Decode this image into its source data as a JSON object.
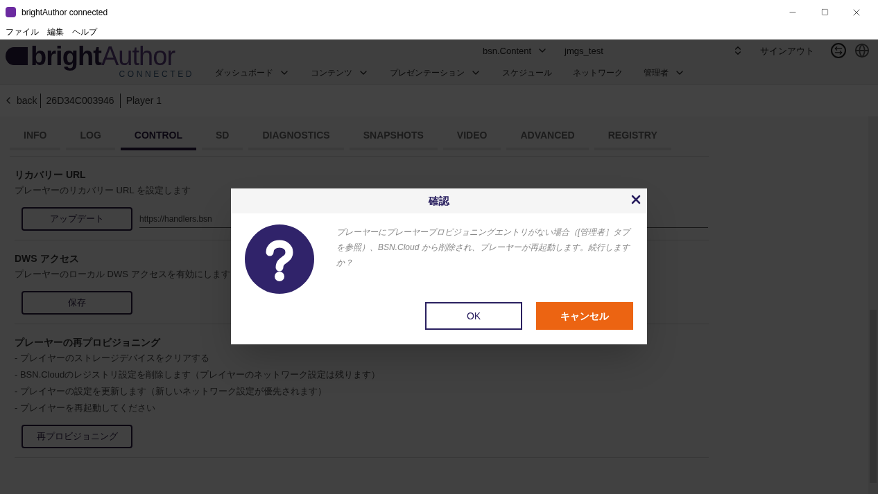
{
  "window": {
    "title": "brightAuthor connected"
  },
  "menu": [
    "ファイル",
    "編集",
    "ヘルプ"
  ],
  "header": {
    "logo_main": "bright",
    "logo_accent": "Author",
    "logo_sub": "CONNECTED",
    "network": "bsn.Content",
    "user": "jmgs_test",
    "sign_out": "サインアウト",
    "nav": [
      {
        "label": "ダッシュボード",
        "dropdown": true
      },
      {
        "label": "コンテンツ",
        "dropdown": true
      },
      {
        "label": "プレゼンテーション",
        "dropdown": true
      },
      {
        "label": "スケジュール",
        "dropdown": false
      },
      {
        "label": "ネットワーク",
        "dropdown": false
      },
      {
        "label": "管理者",
        "dropdown": true
      }
    ]
  },
  "breadcrumb": {
    "back": "back",
    "serial": "26D34C003946",
    "player": "Player 1"
  },
  "tabs": [
    {
      "label": "INFO",
      "selected": false
    },
    {
      "label": "LOG",
      "selected": false
    },
    {
      "label": "CONTROL",
      "selected": true
    },
    {
      "label": "SD",
      "selected": false
    },
    {
      "label": "DIAGNOSTICS",
      "selected": false
    },
    {
      "label": "SNAPSHOTS",
      "selected": false
    },
    {
      "label": "VIDEO",
      "selected": false
    },
    {
      "label": "ADVANCED",
      "selected": false
    },
    {
      "label": "REGISTRY",
      "selected": false
    }
  ],
  "sections": [
    {
      "title": "リカバリー URL",
      "description": [
        "プレーヤーのリカバリー URL を設定します"
      ],
      "button": "アップデート",
      "field_value": "https://handlers.bsn"
    },
    {
      "title": "DWS アクセス",
      "description": [
        "プレーヤーのローカル DWS アクセスを有効にします"
      ],
      "button": "保存"
    },
    {
      "title": "プレーヤーの再プロビジョニング",
      "description": [
        "- プレイヤーのストレージデバイスをクリアする",
        "- BSN.Cloudのレジストリ設定を削除します（プレイヤーのネットワーク設定は残ります）",
        "- プレイヤーの設定を更新します（新しいネットワーク設定が優先されます）",
        "- プレイヤーを再起動してください"
      ],
      "button": "再プロビジョニング"
    }
  ],
  "dialog": {
    "title": "確認",
    "message": "プレーヤーにプレーヤープロビジョニングエントリがない場合（[管理者］タブを参照）、BSN.Cloud から削除され、プレーヤーが再起動します。続行しますか？",
    "ok": "OK",
    "cancel": "キャンセル"
  }
}
